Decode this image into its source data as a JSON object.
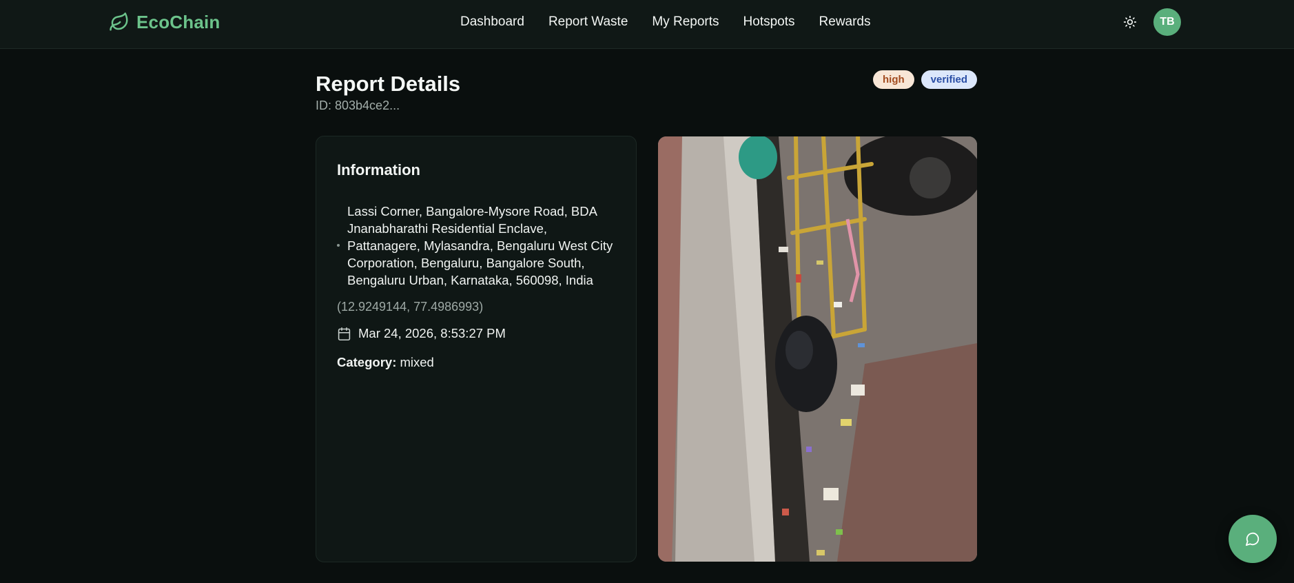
{
  "brand": {
    "name": "EcoChain",
    "icon": "leaf-icon",
    "color": "#6cc38b"
  },
  "nav": {
    "links": [
      "Dashboard",
      "Report Waste",
      "My Reports",
      "Hotspots",
      "Rewards"
    ]
  },
  "header_actions": {
    "theme_icon": "sun-icon",
    "avatar_initials": "TB"
  },
  "report": {
    "title": "Report Details",
    "id_text": "ID: 803b4ce2...",
    "badges": {
      "severity": "high",
      "status": "verified"
    }
  },
  "info": {
    "title": "Information",
    "address": "Lassi Corner, Bangalore-Mysore Road, BDA Jnanabharathi Residential Enclave, Pattanagere, Mylasandra, Bengaluru West City Corporation, Bengaluru, Bangalore South, Bengaluru Urban, Karnataka, 560098, India",
    "coordinates": "(12.9249144, 77.4986993)",
    "date": "Mar 24, 2026, 8:53:27 PM",
    "category_label": "Category:",
    "category_value": "mixed"
  },
  "chat": {
    "icon": "chat-bubble-icon"
  },
  "colors": {
    "accent": "#5aaf7c",
    "background": "#0a0f0e",
    "card": "#0f1715",
    "badge_high_bg": "#f8e6d6",
    "badge_verified_bg": "#dce7fb"
  }
}
